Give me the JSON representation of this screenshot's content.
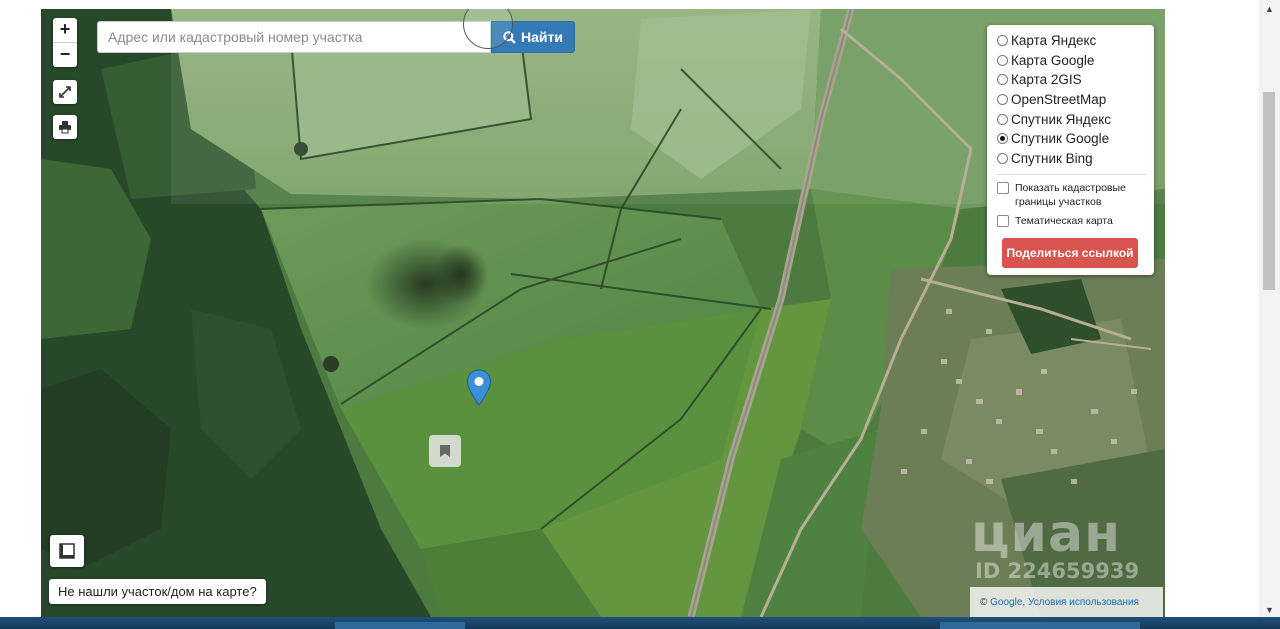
{
  "map": {
    "zoom_in": "+",
    "zoom_out": "−",
    "search": {
      "placeholder": "Адрес или кадастровый номер участка",
      "value": ""
    },
    "find_button": "Найти",
    "layers": {
      "items": [
        {
          "label": "Карта Яндекс",
          "selected": false
        },
        {
          "label": "Карта Google",
          "selected": false
        },
        {
          "label": "Карта 2GIS",
          "selected": false
        },
        {
          "label": "OpenStreetMap",
          "selected": false
        },
        {
          "label": "Спутник Яндекс",
          "selected": false
        },
        {
          "label": "Спутник Google",
          "selected": true
        },
        {
          "label": "Спутник Bing",
          "selected": false
        }
      ],
      "options": [
        {
          "label": "Показать кадастровые границы участков",
          "checked": false
        },
        {
          "label": "Тематическая карта",
          "checked": false
        }
      ],
      "share_button": "Поделиться ссылкой"
    },
    "not_found_button": "Не нашли участок/дом на карте?",
    "attribution": {
      "copyright": "©",
      "google_link": "Google",
      "separator": ",",
      "terms_link": "Условия использования"
    },
    "watermark": {
      "logo": "циан",
      "id": "ID 224659939"
    },
    "colors": {
      "find_button": "#337ab7",
      "share_button": "#d9534f",
      "marker": "#3b8fd6"
    }
  }
}
